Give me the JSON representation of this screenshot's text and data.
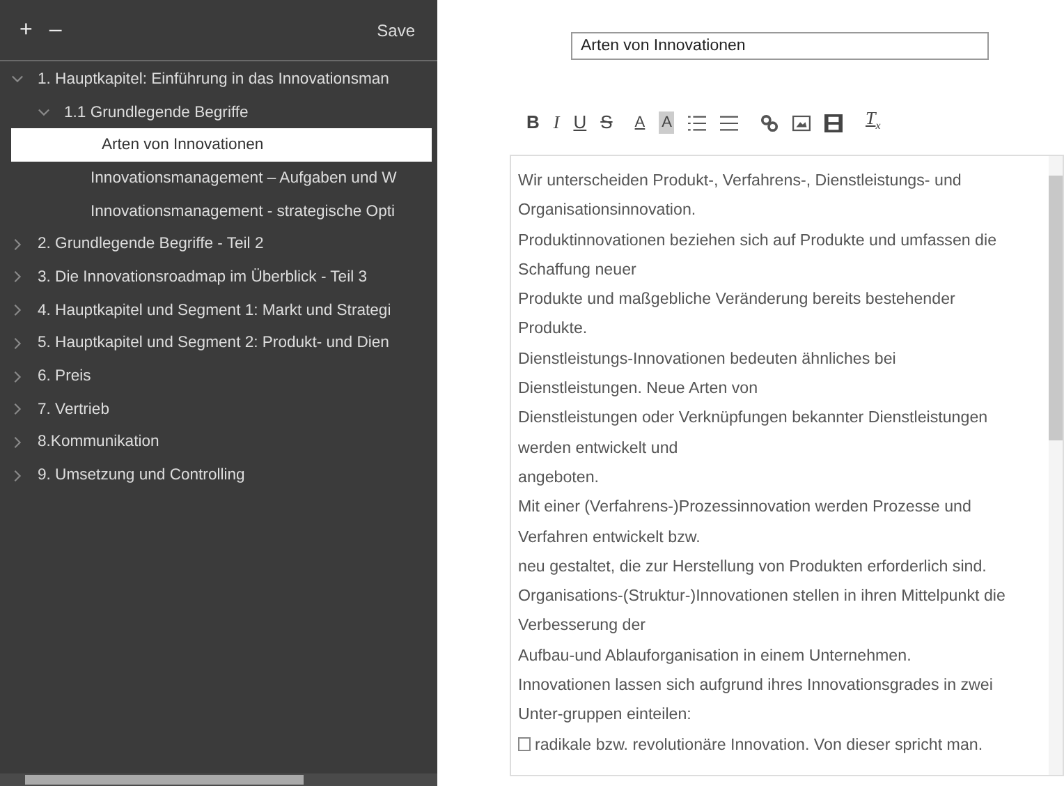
{
  "sidebar": {
    "add": "+",
    "remove": "–",
    "save": "Save",
    "tree": [
      {
        "label": "1. Hauptkapitel: Einführung in das Innovationsman",
        "expanded": true,
        "selected": false,
        "children": [
          {
            "label": "1.1 Grundlegende Begriffe",
            "expanded": true,
            "selected": false,
            "children": [
              {
                "label": "Arten von Innovationen",
                "selected": true
              },
              {
                "label": "Innovationsmanagement – Aufgaben und W",
                "selected": false
              },
              {
                "label": "Innovationsmanagement - strategische Opti",
                "selected": false
              }
            ]
          }
        ]
      },
      {
        "label": "2. Grundlegende Begriffe - Teil 2",
        "expanded": false,
        "selected": false
      },
      {
        "label": "3. Die Innovationsroadmap im Überblick - Teil 3",
        "expanded": false,
        "selected": false
      },
      {
        "label": "4. Hauptkapitel und Segment 1: Markt und Strategi",
        "expanded": false,
        "selected": false
      },
      {
        "label": "5. Hauptkapitel und Segment 2: Produkt- und Dien",
        "expanded": false,
        "selected": false
      },
      {
        "label": "6. Preis",
        "expanded": false,
        "selected": false
      },
      {
        "label": "7. Vertrieb",
        "expanded": false,
        "selected": false
      },
      {
        "label": "8.Kommunikation",
        "expanded": false,
        "selected": false
      },
      {
        "label": "9. Umsetzung und Controlling",
        "expanded": false,
        "selected": false
      }
    ]
  },
  "title_field": {
    "value": "Arten von Innovationen"
  },
  "editor": {
    "toolbar": [
      {
        "kind": "bold",
        "label": "B"
      },
      {
        "kind": "italic",
        "label": "I"
      },
      {
        "kind": "underline",
        "label": "U"
      },
      {
        "kind": "strike",
        "label": "S"
      },
      {
        "kind": "textcolor",
        "label": "A"
      },
      {
        "kind": "bgcolor",
        "label": "A"
      },
      {
        "kind": "numlist"
      },
      {
        "kind": "bulletlist"
      },
      {
        "kind": "link"
      },
      {
        "kind": "image"
      },
      {
        "kind": "video"
      },
      {
        "kind": "clear",
        "label": "T",
        "sub": "x"
      }
    ],
    "lines": [
      "Wir unterscheiden Produkt-, Verfahrens-, Dienstleistungs- und",
      "Organisationsinnovation.",
      "Produktinnovationen beziehen sich auf Produkte und umfassen die",
      "Schaffung neuer",
      "Produkte und maßgebliche Veränderung bereits bestehender",
      "Produkte.",
      "Dienstleistungs-Innovationen bedeuten ähnliches bei",
      "Dienstleistungen. Neue Arten von",
      "Dienstleistungen oder Verknüpfungen bekannter Dienstleistungen",
      "werden entwickelt und",
      "angeboten.",
      "Mit einer (Verfahrens-)Prozessinnovation werden Prozesse und",
      "Verfahren entwickelt bzw.",
      "neu gestaltet, die zur Herstellung von Produkten erforderlich sind.",
      "Organisations-(Struktur-)Innovationen stellen in ihren Mittelpunkt die",
      "Verbesserung der",
      "Aufbau-und Ablauforganisation in einem Unternehmen.",
      "Innovationen lassen sich aufgrund ihres Innovationsgrades in zwei",
      "Unter-gruppen einteilen:",
      "radikale bzw. revolutionäre Innovation. Von dieser spricht man."
    ]
  }
}
